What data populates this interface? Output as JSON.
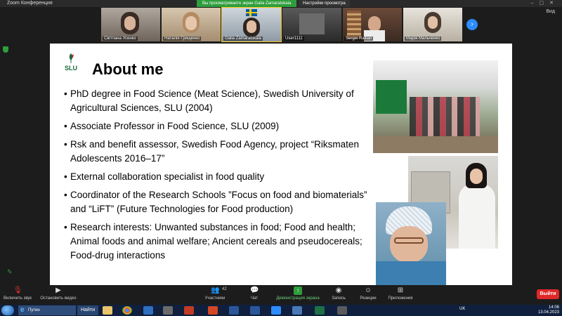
{
  "window": {
    "title": "Zoom Конференция",
    "share_banner": "Вы просматриваете экран Galia Zamaratskaia",
    "share_options": "Настройки просмотра",
    "view_label": "Вид"
  },
  "participants": [
    {
      "name": "Світлана Усенко"
    },
    {
      "name": "Наталія Грищенко"
    },
    {
      "name": "Galia Zamaratskaia"
    },
    {
      "name": "User1111"
    },
    {
      "name": "Sergei Railian"
    },
    {
      "name": "Марія Мальченко"
    }
  ],
  "slide": {
    "logo_text": "SLU",
    "title": "About me",
    "bullets": [
      "PhD degree in Food Science (Meat Science), Swedish University of Agricultural Sciences, SLU (2004)",
      "Associate Professor in Food Science, SLU (2009)",
      "Rsk and benefit assessor, Swedish Food Agency, project “Riksmaten Adolescents 2016–17”",
      "External collaboration specialist in food quality",
      "Coordinator of the Research Schools ”Focus on food and biomaterials” and “LiFT” (Future Technologies for Food production)",
      "Research interests: Unwanted substances in food; Food and health; Animal foods and animal welfare; Ancient cereals and pseudocereals; Food-drug interactions"
    ]
  },
  "toolbar": {
    "unmute": "Включить звук",
    "stop_video": "Остановить видео",
    "participants": "Участники",
    "participants_count": "42",
    "chat": "Чат",
    "share_screen": "Демонстрация экрана",
    "record": "Запись",
    "reactions": "Реакции",
    "apps": "Приложения",
    "leave": "Выйти"
  },
  "taskbar": {
    "ie_label": "Путин",
    "naiti": "Найти",
    "lang": "UK",
    "time": "14:06",
    "date": "13.04.2023"
  },
  "colors": {
    "zoom_blue": "#2d8cff",
    "share_green": "#2e9e3c",
    "leave_red": "#e02828",
    "slu_green": "#1a6b3a",
    "slu_red": "#c8102e"
  }
}
